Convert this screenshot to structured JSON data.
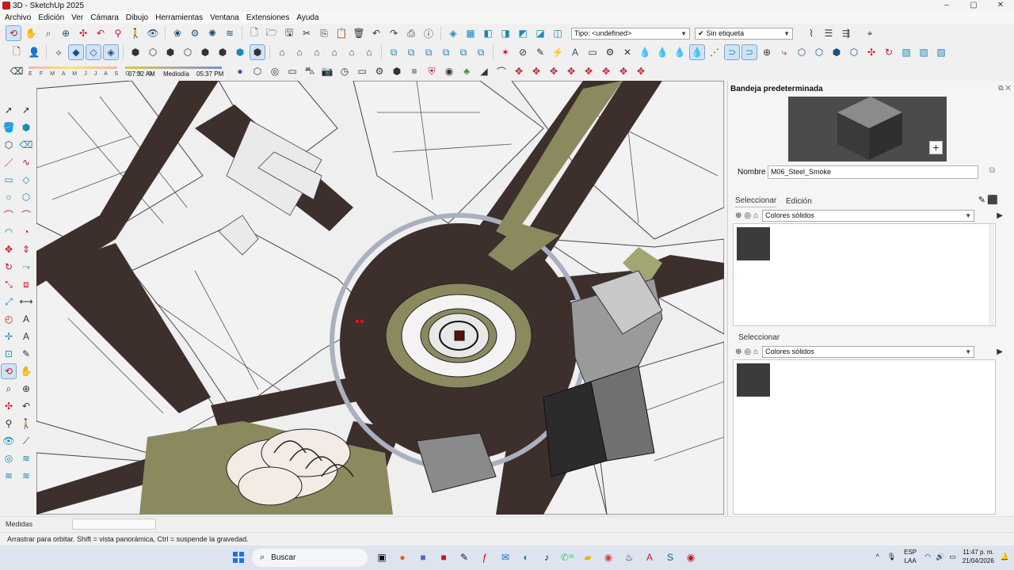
{
  "window": {
    "title": "3D - SketchUp 2025",
    "controls": [
      "–",
      "▢",
      "✕"
    ]
  },
  "menu": [
    "Archivo",
    "Edición",
    "Ver",
    "Cámara",
    "Dibujo",
    "Herramientas",
    "Ventana",
    "Extensiones",
    "Ayuda"
  ],
  "toolbar": {
    "type_combo": "Tipo: <undefined>",
    "tag_combo": "Sin etiqueta",
    "tag_check": "✔"
  },
  "shadows": {
    "months": "E F M A M J J A S O N D",
    "time_start": "07:32 AM",
    "noon": "Mediodía",
    "time_end": "05:37 PM"
  },
  "tray": {
    "title": "Bandeja predeterminada",
    "name_label": "Nombre",
    "material_name": "M06_Steel_Smoke",
    "tab_select": "Seleccionar",
    "tab_edit": "Edición",
    "library_combo": "Colores sólidos",
    "select2_label": "Seleccionar",
    "library_combo2": "Colores sólidos",
    "swatch_color": "#3b3b3b"
  },
  "measurements": {
    "label": "Medidas",
    "value": ""
  },
  "status_text": "Arrastrar para orbitar. Shift = vista panorámica, Ctrl = suspende la gravedad.",
  "taskbar": {
    "search_placeholder": "Buscar",
    "lang_1": "ESP",
    "lang_2": "LAA",
    "time": "11:47 p. m.",
    "date": "21/04/2026",
    "notif_badge": "39"
  }
}
